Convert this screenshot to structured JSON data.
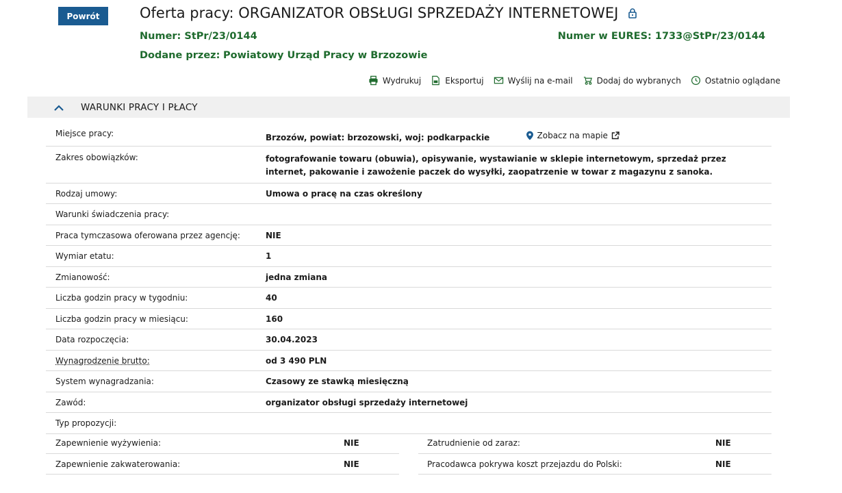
{
  "back_label": "Powrót",
  "title": "Oferta pracy: ORGANIZATOR OBSŁUGI SPRZEDAŻY INTERNETOWEJ",
  "offer_number": "Numer: StPr/23/0144",
  "eures_number": "Numer w EURES: 1733@StPr/23/0144",
  "added_by": {
    "label": "Dodane przez:",
    "value": "Powiatowy Urząd Pracy w Brzozowie"
  },
  "toolbar": {
    "print": "Wydrukuj",
    "export": "Eksportuj",
    "email": "Wyślij na e-mail",
    "favorite": "Dodaj do wybranych",
    "recent": "Ostatnio oglądane"
  },
  "colors": {
    "accent": "#1a5b91",
    "green": "#1f6b2e"
  },
  "section_title": "WARUNKI PRACY I PŁACY",
  "map_link": "Zobacz na mapie",
  "rows": [
    {
      "label": "Miejsce pracy:",
      "value": "Brzozów, powiat: brzozowski, woj: podkarpackie"
    },
    {
      "label": "Zakres obowiązków:",
      "value": "fotografowanie towaru (obuwia), opisywanie, wystawianie w sklepie internetowym, sprzedaż przez internet, pakowanie i zawożenie paczek do wysyłki, zaopatrzenie w towar z magazynu z sanoka."
    },
    {
      "label": "Rodzaj umowy:",
      "value": "Umowa o pracę na czas określony"
    },
    {
      "label": "Warunki świadczenia pracy:",
      "value": ""
    },
    {
      "label": "Praca tymczasowa oferowana przez agencję:",
      "value": "NIE"
    },
    {
      "label": "Wymiar etatu:",
      "value": "1"
    },
    {
      "label": "Zmianowość:",
      "value": "jedna zmiana"
    },
    {
      "label": "Liczba godzin pracy w tygodniu:",
      "value": "40"
    },
    {
      "label": "Liczba godzin pracy w miesiącu:",
      "value": "160"
    },
    {
      "label": "Data rozpoczęcia:",
      "value": "30.04.2023"
    },
    {
      "label": "Wynagrodzenie brutto:",
      "value": "od 3 490 PLN"
    },
    {
      "label": "System wynagradzania:",
      "value": "Czasowy ze stawką miesięczną"
    },
    {
      "label": "Zawód:",
      "value": "organizator obsługi sprzedaży internetowej"
    },
    {
      "label": "Typ propozycji:",
      "value": ""
    }
  ],
  "half_rows": [
    {
      "left_label": "Zapewnienie wyżywienia:",
      "left_value": "NIE",
      "right_label": "Zatrudnienie od zaraz:",
      "right_value": "NIE"
    },
    {
      "left_label": "Zapewnienie zakwaterowania:",
      "left_value": "NIE",
      "right_label": "Pracodawca pokrywa koszt przejazdu do Polski:",
      "right_value": "NIE"
    }
  ]
}
